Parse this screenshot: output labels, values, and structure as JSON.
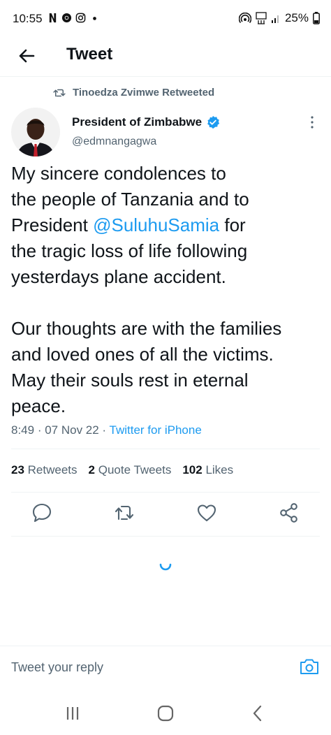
{
  "status_bar": {
    "time": "10:55",
    "battery": "25%",
    "left_icons": [
      "netflix-icon",
      "chrome-icon",
      "instagram-icon",
      "dot-icon"
    ],
    "right_icons": [
      "hotspot-icon",
      "volte-icon",
      "signal-icon",
      "battery-icon"
    ]
  },
  "header": {
    "title": "Tweet"
  },
  "retweet": {
    "label": "Tinoedza Zvimwe Retweeted"
  },
  "author": {
    "name": "President of Zimbabwe",
    "handle": "@edmnangagwa"
  },
  "tweet": {
    "line1": "My sincere condolences to",
    "line2": "the people of Tanzania and to",
    "line3_pre": "President ",
    "mention": "@SuluhuSamia",
    "line3_post": " for",
    "line4": "the tragic loss of life following",
    "line5": "yesterdays plane accident.",
    "line6": "Our thoughts are with the families",
    "line7": "and loved ones of all the victims.",
    "line8": "May their souls rest in eternal",
    "line9": "peace."
  },
  "meta": {
    "time": "8:49",
    "sep1": " · ",
    "date": "07 Nov 22",
    "sep2": " · ",
    "source": "Twitter for iPhone"
  },
  "stats": {
    "retweets_count": "23",
    "retweets_label": "Retweets",
    "quotes_count": "2",
    "quotes_label": "Quote Tweets",
    "likes_count": "102",
    "likes_label": "Likes"
  },
  "reply": {
    "placeholder": "Tweet your reply"
  },
  "colors": {
    "accent": "#1d9bf0",
    "text_primary": "#0f1419",
    "text_secondary": "#536471",
    "divider": "#eff3f4"
  }
}
